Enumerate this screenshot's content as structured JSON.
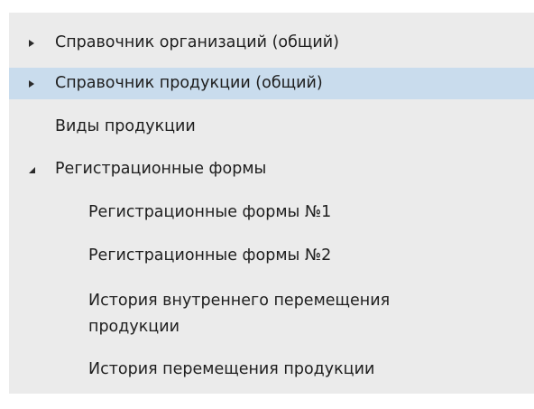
{
  "tree": {
    "items": [
      {
        "label": "Справочник организаций (общий)",
        "toggle": "collapsed"
      },
      {
        "label": "Справочник продукции (общий)",
        "toggle": "collapsed",
        "selected": true
      },
      {
        "label": "Виды продукции",
        "toggle": "none"
      },
      {
        "label": "Регистрационные формы",
        "toggle": "expanded"
      },
      {
        "label": "Регистрационные формы №1",
        "toggle": "none"
      },
      {
        "label": "Регистрационные формы №2",
        "toggle": "none"
      },
      {
        "label": "История внутреннего перемещения продукции",
        "toggle": "none"
      },
      {
        "label": "История перемещения продукции",
        "toggle": "none"
      }
    ]
  },
  "colors": {
    "panel_background": "#ebebeb",
    "selected_background": "#c9dced",
    "text": "#1e1e1e"
  }
}
